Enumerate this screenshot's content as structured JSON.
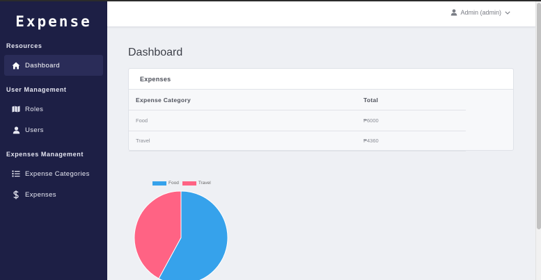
{
  "brand": "Expense",
  "sidebar": {
    "sections": [
      {
        "title": "Resources"
      },
      {
        "title": "User Management"
      },
      {
        "title": "Expenses Management"
      }
    ],
    "items": [
      {
        "label": "Dashboard",
        "icon": "home-icon",
        "active": true
      },
      {
        "label": "Roles",
        "icon": "map-icon"
      },
      {
        "label": "Users",
        "icon": "user-icon"
      },
      {
        "label": "Expense Categories",
        "icon": "list-icon"
      },
      {
        "label": "Expenses",
        "icon": "dollar-icon"
      }
    ]
  },
  "topbar": {
    "user": "Admin (admin)",
    "user_icon": "user-icon",
    "caret_icon": "chevron-down-icon"
  },
  "page": {
    "title": "Dashboard"
  },
  "card": {
    "title": "Expenses",
    "columns": [
      "Expense Category",
      "Total"
    ],
    "rows": [
      {
        "category": "Food",
        "total": "₱6000"
      },
      {
        "category": "Travel",
        "total": "₱4360"
      }
    ]
  },
  "colors": {
    "sidebar": "#1d1f45",
    "food": "#36a2eb",
    "travel": "#ff6384"
  },
  "chart_data": {
    "type": "pie",
    "categories": [
      "Food",
      "Travel"
    ],
    "values": [
      6000,
      4360
    ],
    "colors": [
      "#36a2eb",
      "#ff6384"
    ],
    "legend": "top"
  }
}
